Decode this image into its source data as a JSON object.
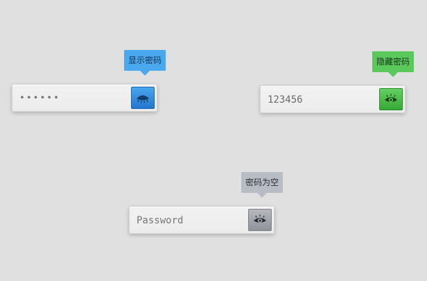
{
  "colors": {
    "background": "#e0e0e0",
    "show_accent": "#2d86dc",
    "hide_accent": "#45b845",
    "empty_accent": "#a3a6ad"
  },
  "fields": [
    {
      "tooltip": "显示密码",
      "value": "••••••",
      "state": "masked",
      "toggle_icon": "eye-closed-icon"
    },
    {
      "tooltip": "隐藏密码",
      "value": "123456",
      "state": "visible",
      "toggle_icon": "eye-icon"
    },
    {
      "tooltip": "密码为空",
      "value": "",
      "placeholder": "Password",
      "state": "empty",
      "toggle_icon": "eye-icon"
    }
  ]
}
